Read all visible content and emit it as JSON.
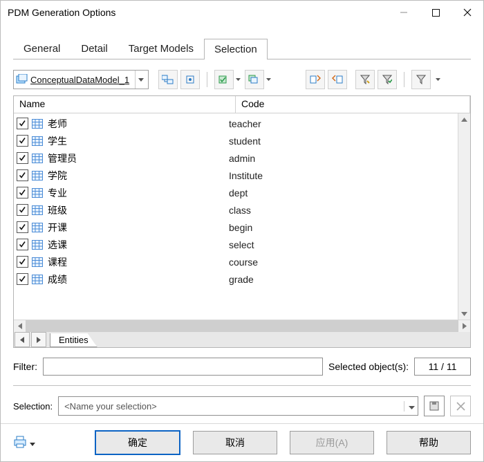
{
  "window": {
    "title": "PDM Generation Options"
  },
  "tabs": [
    {
      "label": "General",
      "active": false
    },
    {
      "label": "Detail",
      "active": false
    },
    {
      "label": "Target Models",
      "active": false
    },
    {
      "label": "Selection",
      "active": true
    }
  ],
  "model_combo": {
    "label": "ConceptualDataModel_1"
  },
  "columns": {
    "name": "Name",
    "code": "Code"
  },
  "rows": [
    {
      "checked": true,
      "name": "老师",
      "code": "teacher"
    },
    {
      "checked": true,
      "name": "学生",
      "code": "student"
    },
    {
      "checked": true,
      "name": "管理员",
      "code": "admin"
    },
    {
      "checked": true,
      "name": "学院",
      "code": "Institute"
    },
    {
      "checked": true,
      "name": "专业",
      "code": "dept"
    },
    {
      "checked": true,
      "name": "班级",
      "code": "class"
    },
    {
      "checked": true,
      "name": "开课",
      "code": "begin"
    },
    {
      "checked": true,
      "name": "选课",
      "code": "select"
    },
    {
      "checked": true,
      "name": "课程",
      "code": "course"
    },
    {
      "checked": true,
      "name": "成绩",
      "code": "grade"
    }
  ],
  "sheet_tab": "Entities",
  "filter": {
    "label": "Filter:"
  },
  "selected_label": "Selected object(s):",
  "selected_count": "11 / 11",
  "selection_label": "Selection:",
  "selection_placeholder": "<Name your selection>",
  "buttons": {
    "ok": "确定",
    "cancel": "取消",
    "apply": "应用(A)",
    "help": "帮助"
  }
}
